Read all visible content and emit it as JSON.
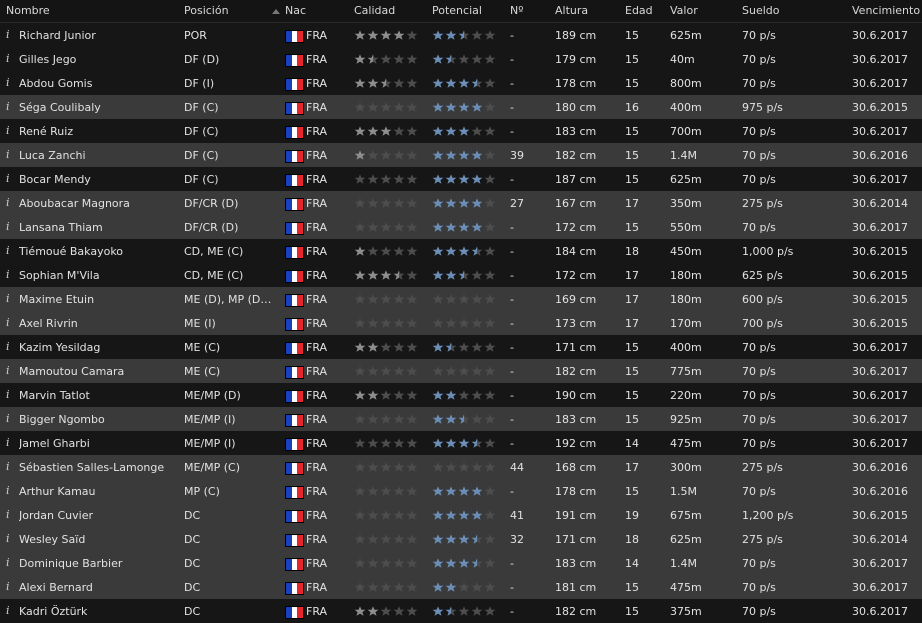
{
  "colors": {
    "flag_blue": "#1a3fbf",
    "flag_white": "#ffffff",
    "flag_red": "#e6262a",
    "quality_star": "#8e8e8e",
    "potential_star": "#6c8db6",
    "empty_star": "#4d4d4d"
  },
  "headers": {
    "name": "Nombre",
    "position": "Posición",
    "nationality": "Nac",
    "quality": "Calidad",
    "potential": "Potencial",
    "number": "Nº",
    "height": "Altura",
    "age": "Edad",
    "value": "Valor",
    "wage": "Sueldo",
    "expiry": "Vencimiento"
  },
  "players": [
    {
      "info": "i",
      "name": "Richard Junior",
      "position": "POR",
      "nat": "FRA",
      "quality": 4,
      "potential": 2.5,
      "number": "-",
      "height": "189 cm",
      "age": "15",
      "value": "625m",
      "wage": "70 p/s",
      "expiry": "30.6.2017",
      "shade": "dark"
    },
    {
      "info": "i",
      "name": "Gilles Jego",
      "position": "DF (D)",
      "nat": "FRA",
      "quality": 1.5,
      "potential": 1.5,
      "number": "-",
      "height": "179 cm",
      "age": "15",
      "value": "40m",
      "wage": "70 p/s",
      "expiry": "30.6.2017",
      "shade": "dark"
    },
    {
      "info": "i",
      "name": "Abdou Gomis",
      "position": "DF (I)",
      "nat": "FRA",
      "quality": 2.5,
      "potential": 3.5,
      "number": "-",
      "height": "178 cm",
      "age": "15",
      "value": "800m",
      "wage": "70 p/s",
      "expiry": "30.6.2017",
      "shade": "dark"
    },
    {
      "info": "i",
      "name": "Séga Coulibaly",
      "position": "DF (C)",
      "nat": "FRA",
      "quality": 0,
      "potential": 4,
      "number": "-",
      "height": "180 cm",
      "age": "16",
      "value": "400m",
      "wage": "975 p/s",
      "expiry": "30.6.2015",
      "shade": "gray"
    },
    {
      "info": "i",
      "name": "René Ruiz",
      "position": "DF (C)",
      "nat": "FRA",
      "quality": 3,
      "potential": 3,
      "number": "-",
      "height": "183 cm",
      "age": "15",
      "value": "700m",
      "wage": "70 p/s",
      "expiry": "30.6.2017",
      "shade": "dark"
    },
    {
      "info": "i",
      "name": "Luca Zanchi",
      "position": "DF (C)",
      "nat": "FRA",
      "quality": 1,
      "potential": 4,
      "number": "39",
      "height": "182 cm",
      "age": "15",
      "value": "1.4M",
      "wage": "70 p/s",
      "expiry": "30.6.2016",
      "shade": "gray"
    },
    {
      "info": "i",
      "name": "Bocar Mendy",
      "position": "DF (C)",
      "nat": "FRA",
      "quality": 0,
      "potential": 4,
      "number": "-",
      "height": "187 cm",
      "age": "15",
      "value": "625m",
      "wage": "70 p/s",
      "expiry": "30.6.2017",
      "shade": "dark"
    },
    {
      "info": "i",
      "name": "Aboubacar Magnora",
      "position": "DF/CR (D)",
      "nat": "FRA",
      "quality": 0,
      "potential": 4,
      "number": "27",
      "height": "167 cm",
      "age": "17",
      "value": "350m",
      "wage": "275 p/s",
      "expiry": "30.6.2014",
      "shade": "gray"
    },
    {
      "info": "i",
      "name": "Lansana Thiam",
      "position": "DF/CR (D)",
      "nat": "FRA",
      "quality": 0,
      "potential": 4,
      "number": "-",
      "height": "172 cm",
      "age": "15",
      "value": "550m",
      "wage": "70 p/s",
      "expiry": "30.6.2017",
      "shade": "gray"
    },
    {
      "info": "i",
      "name": "Tiémoué Bakayoko",
      "position": "CD, ME (C)",
      "nat": "FRA",
      "quality": 1,
      "potential": 3.5,
      "number": "-",
      "height": "184 cm",
      "age": "18",
      "value": "450m",
      "wage": "1,000 p/s",
      "expiry": "30.6.2015",
      "shade": "dark"
    },
    {
      "info": "i",
      "name": "Sophian M'Vila",
      "position": "CD, ME (C)",
      "nat": "FRA",
      "quality": 3.5,
      "potential": 2.5,
      "number": "-",
      "height": "172 cm",
      "age": "17",
      "value": "180m",
      "wage": "625 p/s",
      "expiry": "30.6.2015",
      "shade": "dark"
    },
    {
      "info": "i",
      "name": "Maxime Etuin",
      "position": "ME (D), MP (D…",
      "nat": "FRA",
      "quality": 0,
      "potential": 0,
      "number": "-",
      "height": "169 cm",
      "age": "17",
      "value": "180m",
      "wage": "600 p/s",
      "expiry": "30.6.2015",
      "shade": "gray"
    },
    {
      "info": "i",
      "name": "Axel Rivrin",
      "position": "ME (I)",
      "nat": "FRA",
      "quality": 0,
      "potential": 0,
      "number": "-",
      "height": "173 cm",
      "age": "17",
      "value": "170m",
      "wage": "700 p/s",
      "expiry": "30.6.2015",
      "shade": "gray"
    },
    {
      "info": "i",
      "name": "Kazim Yesildag",
      "position": "ME (C)",
      "nat": "FRA",
      "quality": 2,
      "potential": 1.5,
      "number": "-",
      "height": "171 cm",
      "age": "15",
      "value": "400m",
      "wage": "70 p/s",
      "expiry": "30.6.2017",
      "shade": "dark"
    },
    {
      "info": "i",
      "name": "Mamoutou Camara",
      "position": "ME (C)",
      "nat": "FRA",
      "quality": 0,
      "potential": 0,
      "number": "-",
      "height": "182 cm",
      "age": "15",
      "value": "775m",
      "wage": "70 p/s",
      "expiry": "30.6.2017",
      "shade": "gray"
    },
    {
      "info": "i",
      "name": "Marvin Tatlot",
      "position": "ME/MP (D)",
      "nat": "FRA",
      "quality": 2,
      "potential": 2,
      "number": "-",
      "height": "190 cm",
      "age": "15",
      "value": "220m",
      "wage": "70 p/s",
      "expiry": "30.6.2017",
      "shade": "dark"
    },
    {
      "info": "i",
      "name": "Bigger Ngombo",
      "position": "ME/MP (I)",
      "nat": "FRA",
      "quality": 0,
      "potential": 2.5,
      "number": "-",
      "height": "183 cm",
      "age": "15",
      "value": "925m",
      "wage": "70 p/s",
      "expiry": "30.6.2017",
      "shade": "gray"
    },
    {
      "info": "i",
      "name": "Jamel Gharbi",
      "position": "ME/MP (I)",
      "nat": "FRA",
      "quality": 0,
      "potential": 3.5,
      "number": "-",
      "height": "192 cm",
      "age": "14",
      "value": "475m",
      "wage": "70 p/s",
      "expiry": "30.6.2017",
      "shade": "dark"
    },
    {
      "info": "i",
      "name": "Sébastien Salles-Lamonge",
      "position": "ME/MP (C)",
      "nat": "FRA",
      "quality": 0,
      "potential": 0,
      "number": "44",
      "height": "168 cm",
      "age": "17",
      "value": "300m",
      "wage": "275 p/s",
      "expiry": "30.6.2016",
      "shade": "gray"
    },
    {
      "info": "i",
      "name": "Arthur Kamau",
      "position": "MP (C)",
      "nat": "FRA",
      "quality": 0,
      "potential": 4,
      "number": "-",
      "height": "178 cm",
      "age": "15",
      "value": "1.5M",
      "wage": "70 p/s",
      "expiry": "30.6.2016",
      "shade": "gray"
    },
    {
      "info": "i",
      "name": "Jordan Cuvier",
      "position": "DC",
      "nat": "FRA",
      "quality": 0,
      "potential": 4,
      "number": "41",
      "height": "191 cm",
      "age": "19",
      "value": "675m",
      "wage": "1,200 p/s",
      "expiry": "30.6.2015",
      "shade": "gray"
    },
    {
      "info": "i",
      "name": "Wesley Saïd",
      "position": "DC",
      "nat": "FRA",
      "quality": 0,
      "potential": 3.5,
      "number": "32",
      "height": "171 cm",
      "age": "18",
      "value": "625m",
      "wage": "275 p/s",
      "expiry": "30.6.2014",
      "shade": "gray"
    },
    {
      "info": "i",
      "name": "Dominique Barbier",
      "position": "DC",
      "nat": "FRA",
      "quality": 0,
      "potential": 3.5,
      "number": "-",
      "height": "183 cm",
      "age": "14",
      "value": "1.4M",
      "wage": "70 p/s",
      "expiry": "30.6.2017",
      "shade": "gray"
    },
    {
      "info": "i",
      "name": "Alexi Bernard",
      "position": "DC",
      "nat": "FRA",
      "quality": 0,
      "potential": 2,
      "number": "-",
      "height": "181 cm",
      "age": "15",
      "value": "475m",
      "wage": "70 p/s",
      "expiry": "30.6.2017",
      "shade": "gray"
    },
    {
      "info": "i",
      "name": "Kadri Öztürk",
      "position": "DC",
      "nat": "FRA",
      "quality": 2,
      "potential": 1.5,
      "number": "-",
      "height": "182 cm",
      "age": "15",
      "value": "375m",
      "wage": "70 p/s",
      "expiry": "30.6.2017",
      "shade": "dark"
    }
  ]
}
